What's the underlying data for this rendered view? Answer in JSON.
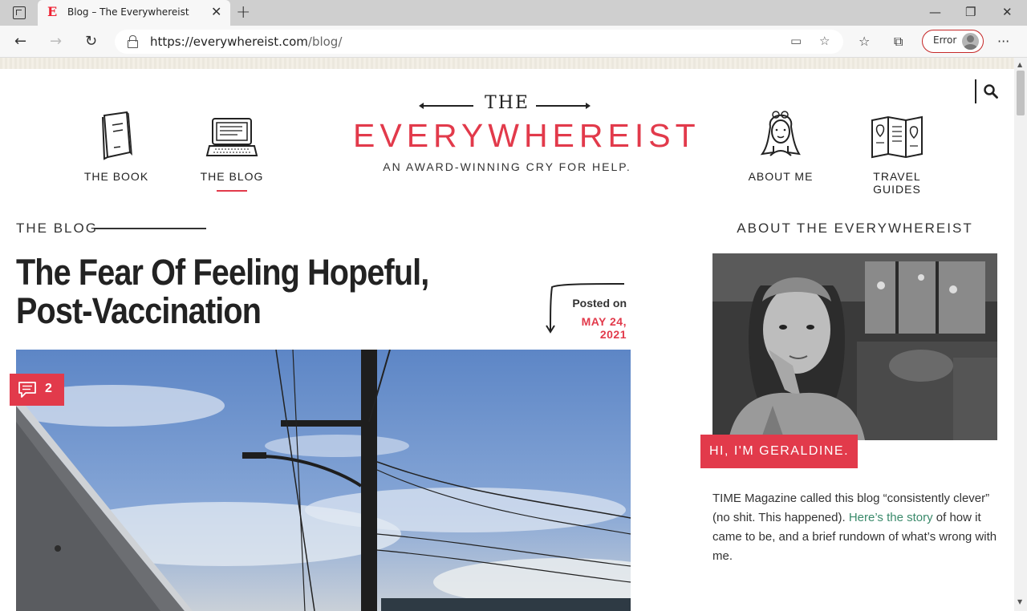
{
  "browser": {
    "tab_title": "Blog – The Everywhereist",
    "tab_favicon": "E",
    "tab_close": "✕",
    "new_tab": "+",
    "url_host": "https://everywhereist.com",
    "url_path": "/blog/",
    "profile_label": "Error",
    "icons": {
      "back": "back-arrow-icon",
      "forward": "forward-arrow-icon",
      "refresh": "refresh-icon",
      "lock": "lock-icon",
      "reader": "immersive-reader-icon",
      "add_favorite": "add-favorite-icon",
      "favorites": "favorites-icon",
      "collections": "collections-icon",
      "menu": "more-menu-icon"
    }
  },
  "site": {
    "brand_color": "#e23a4b",
    "logo": {
      "top": "THE",
      "main": "EVERYWHEREIST",
      "tagline": "AN AWARD-WINNING CRY FOR HELP."
    },
    "nav": [
      {
        "label": "THE BOOK",
        "icon": "book-icon"
      },
      {
        "label": "THE BLOG",
        "icon": "laptop-icon",
        "active": true
      },
      {
        "label": "ABOUT ME",
        "icon": "woman-portrait-icon"
      },
      {
        "label": "TRAVEL GUIDES",
        "icon": "map-icon"
      }
    ]
  },
  "main": {
    "section_label": "THE BLOG",
    "post": {
      "title": "The Fear Of Feeling Hopeful, Post-Vaccination",
      "posted_on_label": "Posted on",
      "date": "MAY 24, 2021",
      "comment_count": "2"
    }
  },
  "sidebar": {
    "heading": "ABOUT THE EVERYWHEREIST",
    "banner": "HI, I'M GERALDINE.",
    "text_before_link": "TIME Magazine called this blog “consistently clever” (no shit. This happened). ",
    "link_text": "Here’s the story",
    "text_after_link": " of how it came to be, and a brief rundown of what’s wrong with me."
  }
}
